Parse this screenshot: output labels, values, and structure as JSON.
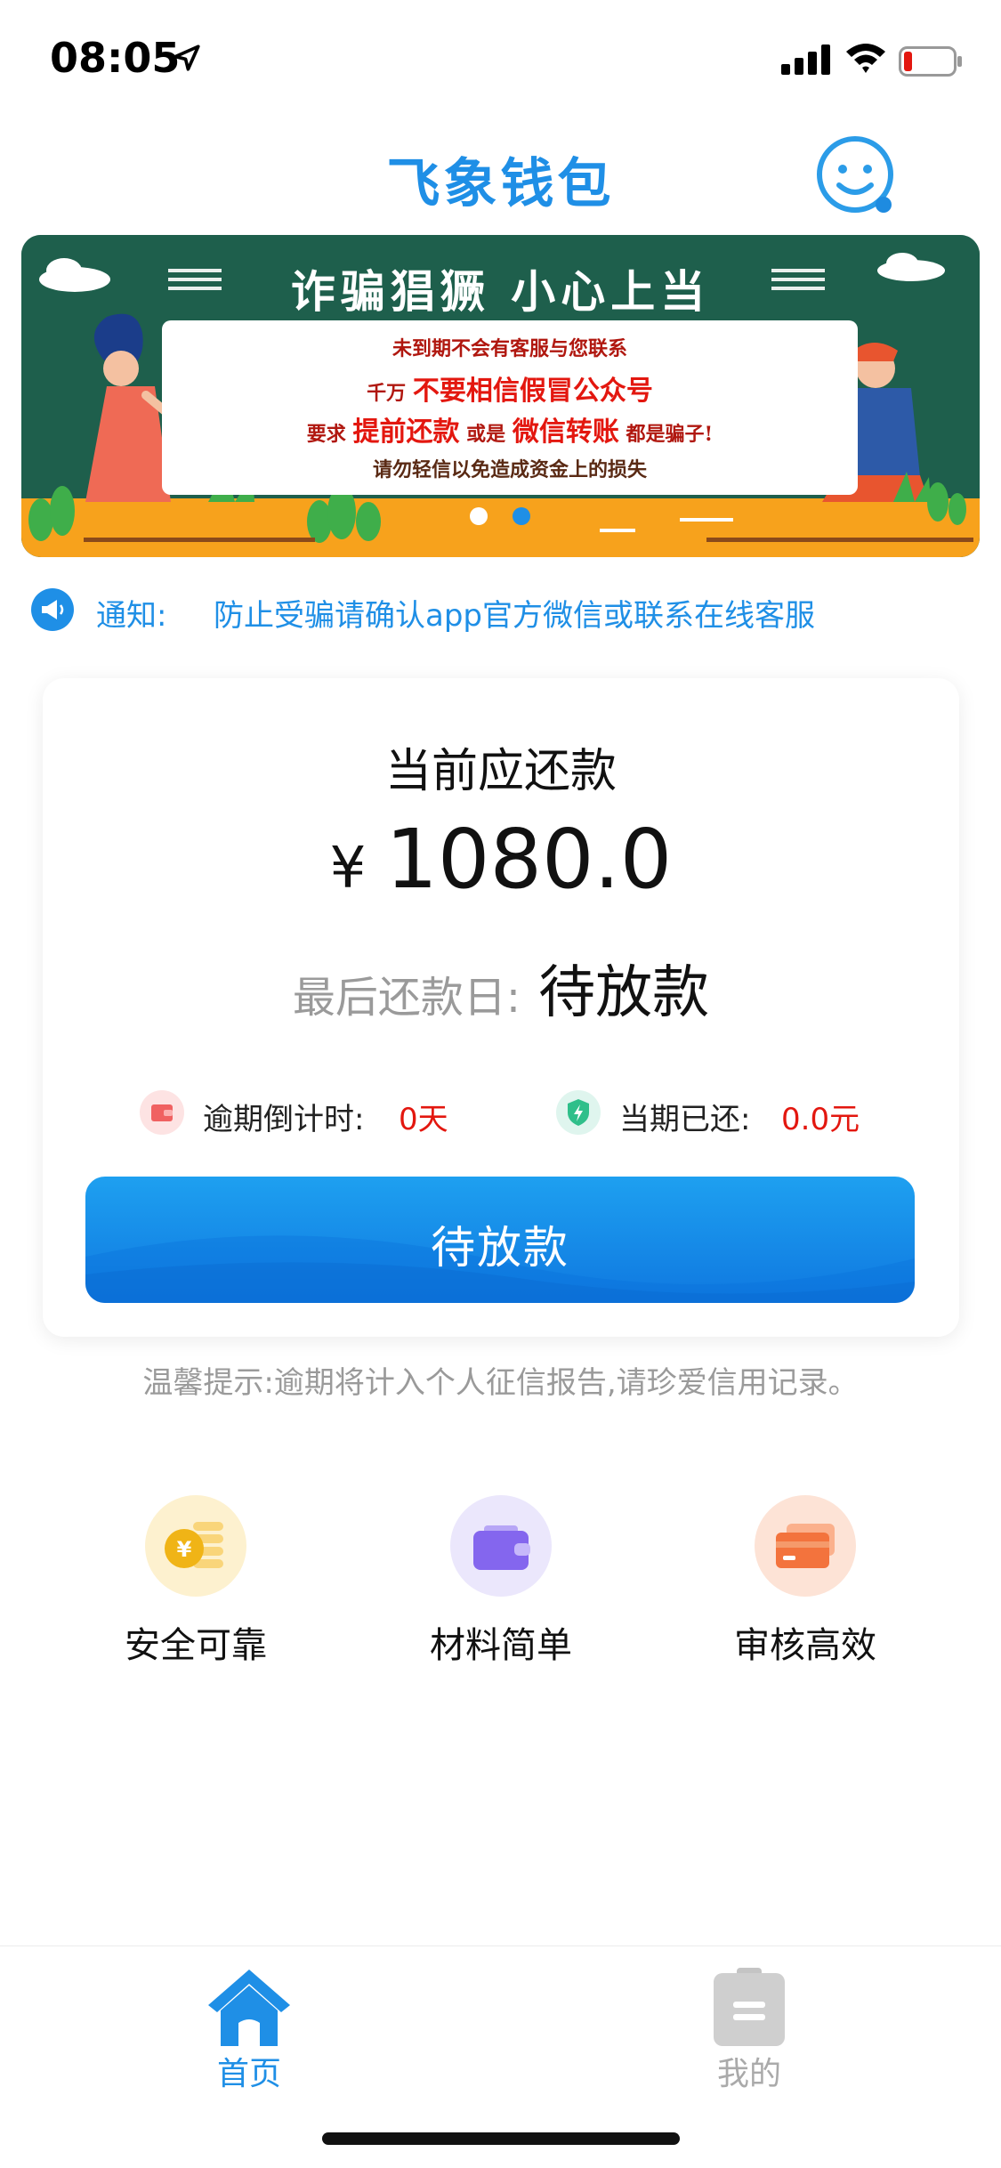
{
  "status_bar": {
    "time": "08:05",
    "icons": [
      "location-arrow-icon",
      "cellular-signal-icon",
      "wifi-icon",
      "battery-low-icon"
    ]
  },
  "header": {
    "title": "飞象钱包",
    "support_icon": "customer-service-face-icon",
    "brand_color": "#1f8fe6"
  },
  "banner": {
    "heading": "诈骗猖獗 小心上当",
    "line1": "未到期不会有客服与您联系",
    "line2_prefix": "千万",
    "line2_em": "不要相信假冒公众号",
    "line3_a": "要求",
    "line3_em1": "提前还款",
    "line3_b": "或是",
    "line3_em2": "微信转账",
    "line3_c": "都是骗子!",
    "line4": "请勿轻信以免造成资金上的损失",
    "slide_count": 2,
    "active_slide": 2
  },
  "notice": {
    "icon": "megaphone-icon",
    "label": "通知:",
    "text": "防止受骗请确认app官方微信或联系在线客服"
  },
  "repayment": {
    "title": "当前应还款",
    "currency": "¥",
    "amount": "1080.0",
    "due_label": "最后还款日:",
    "due_value": "待放款",
    "overdue_label": "逾期倒计时:",
    "overdue_value": "0天",
    "paid_label": "当期已还:",
    "paid_value": "0.0元",
    "button_label": "待放款",
    "value_color": "#e3170f"
  },
  "tip": "温馨提示:逾期将计入个人征信报告,请珍爱信用记录。",
  "features": [
    {
      "label": "安全可靠",
      "icon": "coin-yen-icon"
    },
    {
      "label": "材料简单",
      "icon": "wallet-icon"
    },
    {
      "label": "审核高效",
      "icon": "credit-card-icon"
    }
  ],
  "tab_bar": {
    "tabs": [
      {
        "label": "首页",
        "icon": "home-icon",
        "active": true
      },
      {
        "label": "我的",
        "icon": "clipboard-icon",
        "active": false
      }
    ]
  }
}
